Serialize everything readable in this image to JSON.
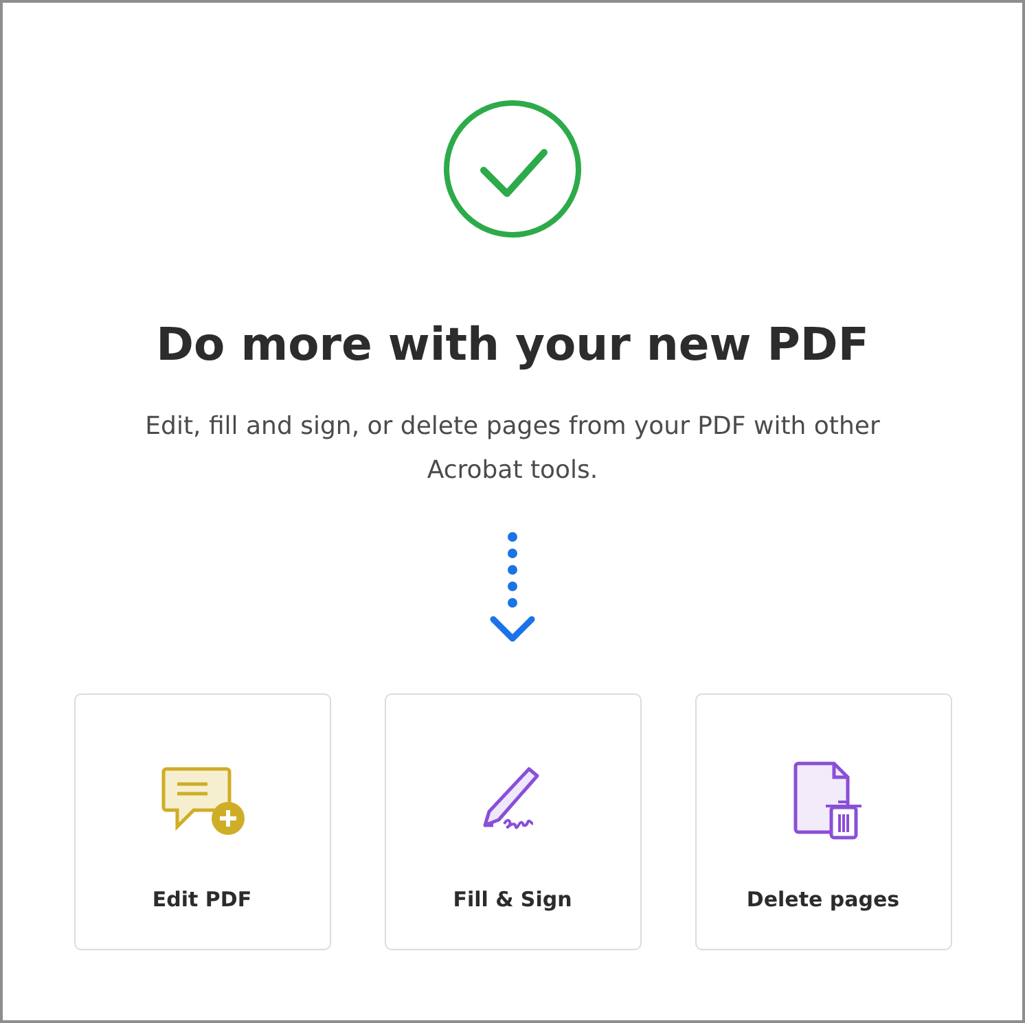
{
  "heading": "Do more with your new PDF",
  "description": "Edit, fill and sign, or delete pages from your PDF with other Acrobat tools.",
  "tools": [
    {
      "kind": "edit",
      "label": "Edit PDF"
    },
    {
      "kind": "sign",
      "label": "Fill & Sign"
    },
    {
      "kind": "delete",
      "label": "Delete pages"
    }
  ]
}
